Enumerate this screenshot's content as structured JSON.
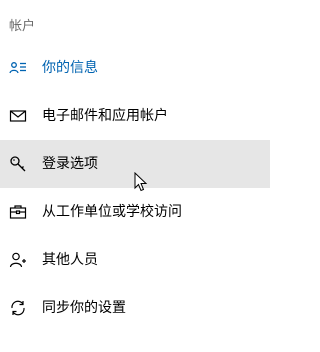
{
  "section_title": "帐户",
  "colors": {
    "accent": "#0063b1",
    "hover_bg": "#e6e6e6",
    "text": "#000000",
    "muted": "#6b6b6b"
  },
  "nav": {
    "items": [
      {
        "label": "你的信息",
        "icon": "person-list-icon",
        "state": "selected"
      },
      {
        "label": "电子邮件和应用帐户",
        "icon": "mail-icon",
        "state": "normal"
      },
      {
        "label": "登录选项",
        "icon": "key-icon",
        "state": "hover"
      },
      {
        "label": "从工作单位或学校访问",
        "icon": "briefcase-icon",
        "state": "normal"
      },
      {
        "label": "其他人员",
        "icon": "person-add-icon",
        "state": "normal"
      },
      {
        "label": "同步你的设置",
        "icon": "sync-icon",
        "state": "normal"
      }
    ]
  }
}
